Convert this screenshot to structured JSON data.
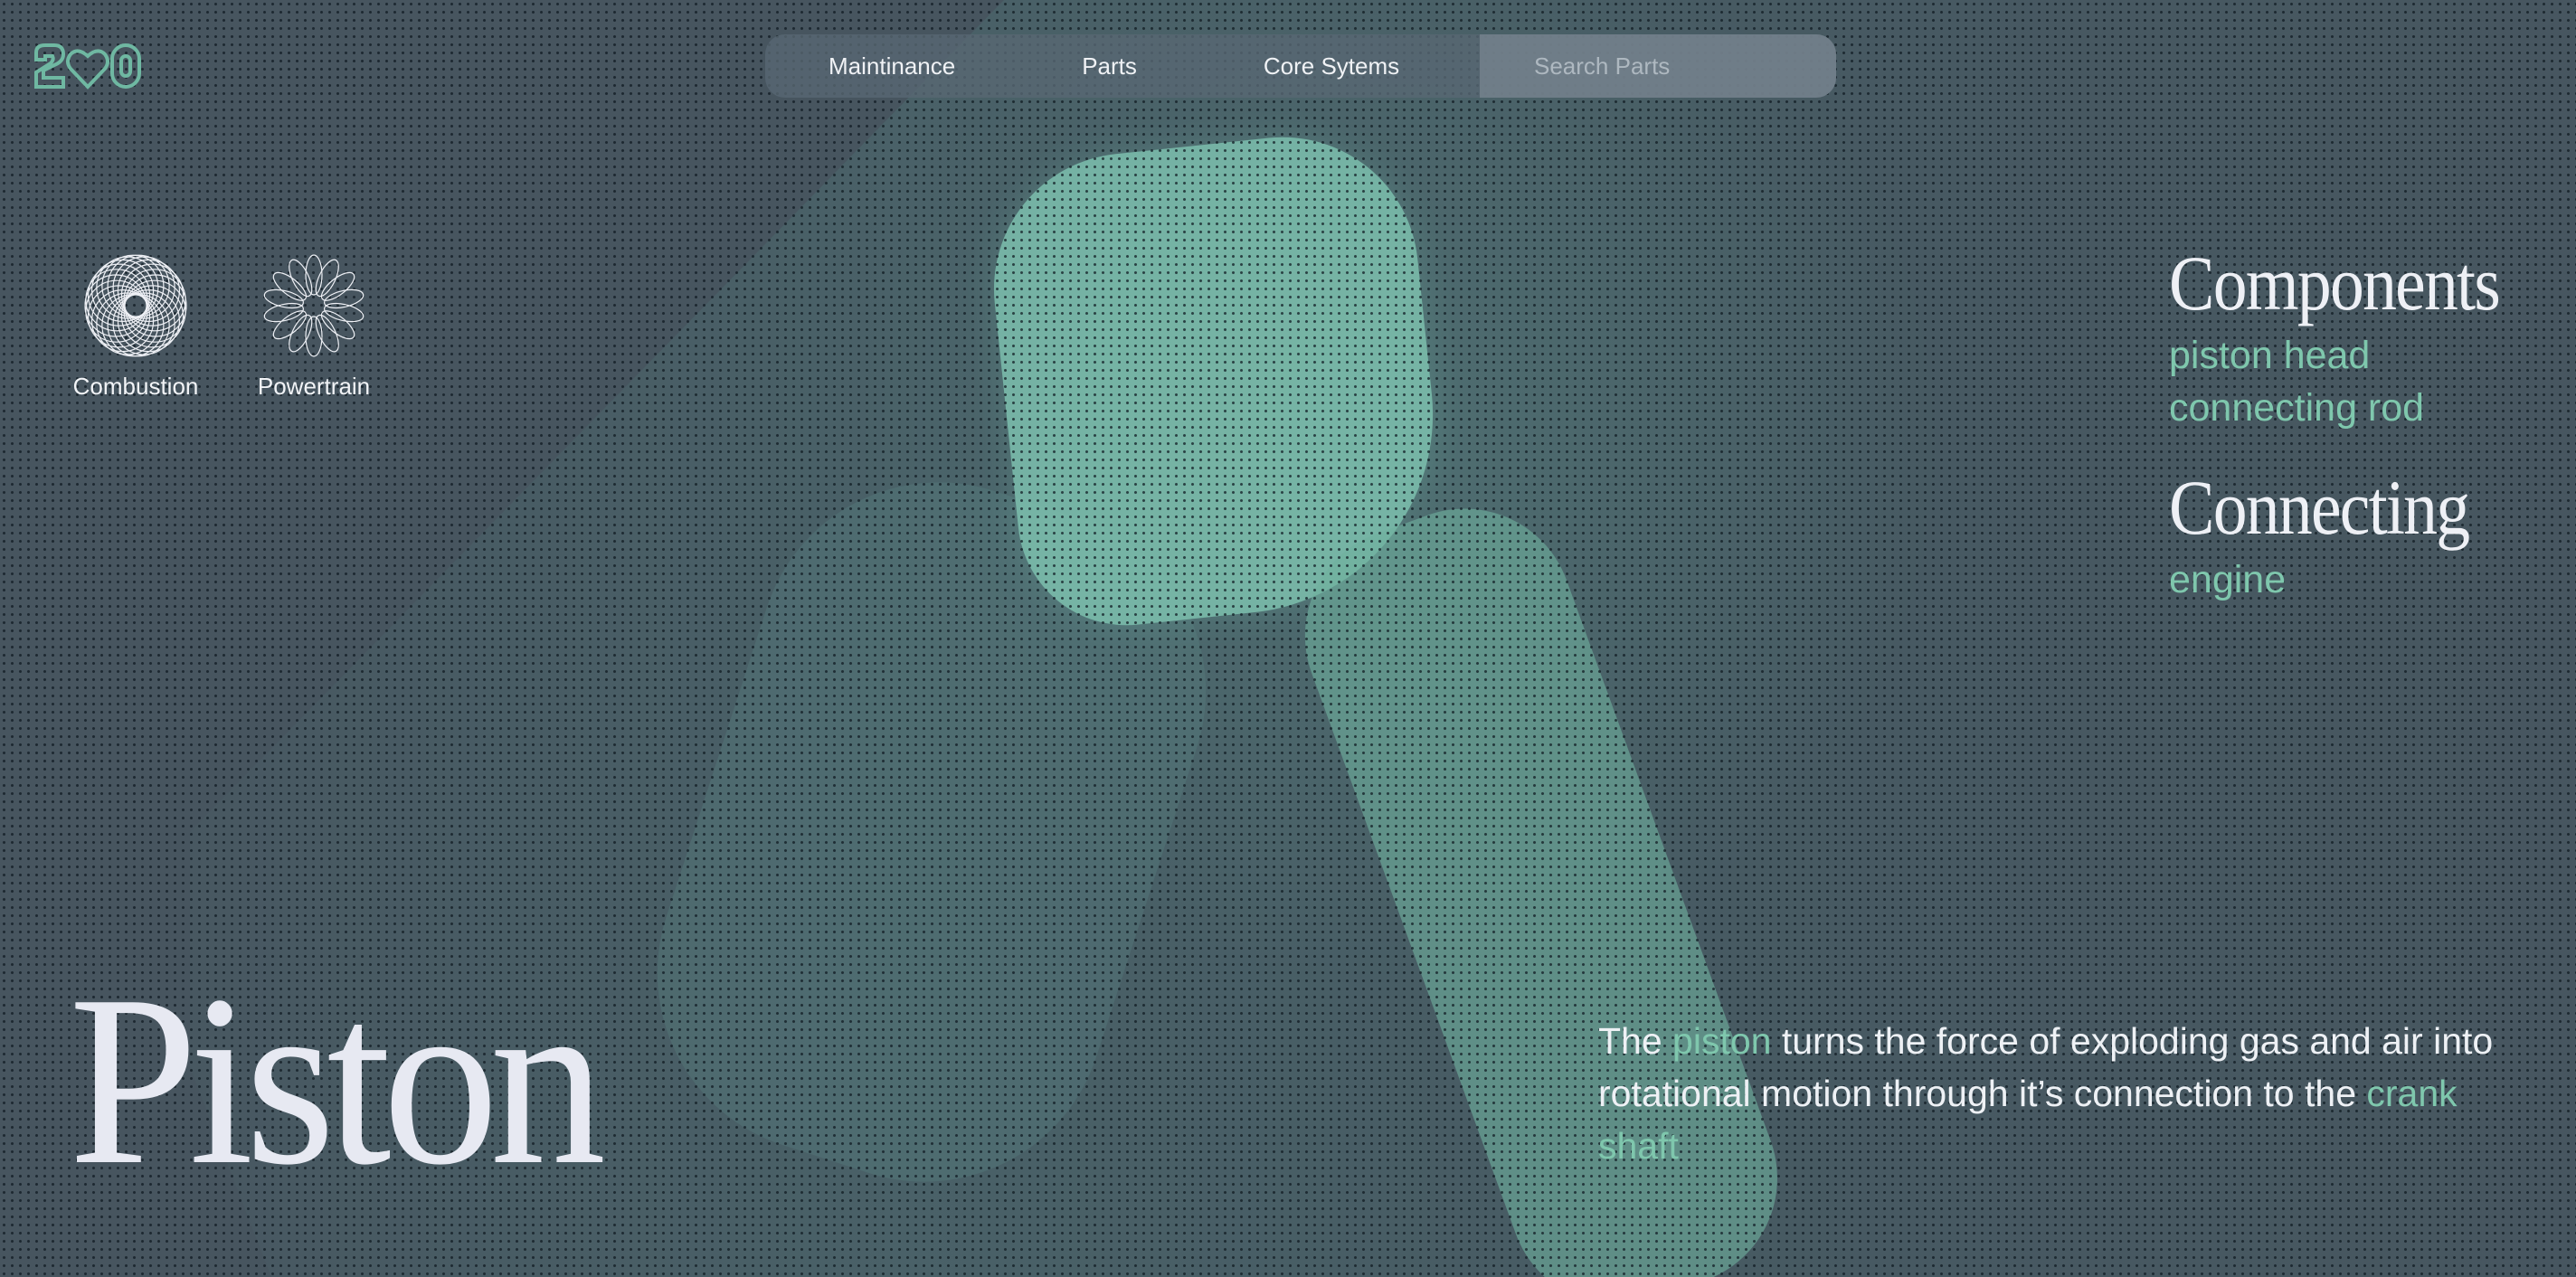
{
  "nav": {
    "items": [
      "Maintinance",
      "Parts",
      "Core Sytems"
    ],
    "search_placeholder": "Search Parts"
  },
  "categories": [
    {
      "label": "Combustion",
      "icon": "spirograph-ring-icon"
    },
    {
      "label": "Powertrain",
      "icon": "spirograph-flower-icon"
    }
  ],
  "side": {
    "components_heading": "Components",
    "components": [
      "piston head",
      "connecting rod"
    ],
    "connecting_heading": "Connecting",
    "connecting": [
      "engine"
    ]
  },
  "title": "Piston",
  "description": {
    "part1": "The ",
    "hl1": "piston",
    "part2": " turns the force of exploding gas and air into rotational motion through it’s connection to the ",
    "hl2": "crank shaft"
  },
  "colors": {
    "background": "#47555f",
    "accent": "#7fc7ad",
    "text": "#e7e9f2"
  }
}
